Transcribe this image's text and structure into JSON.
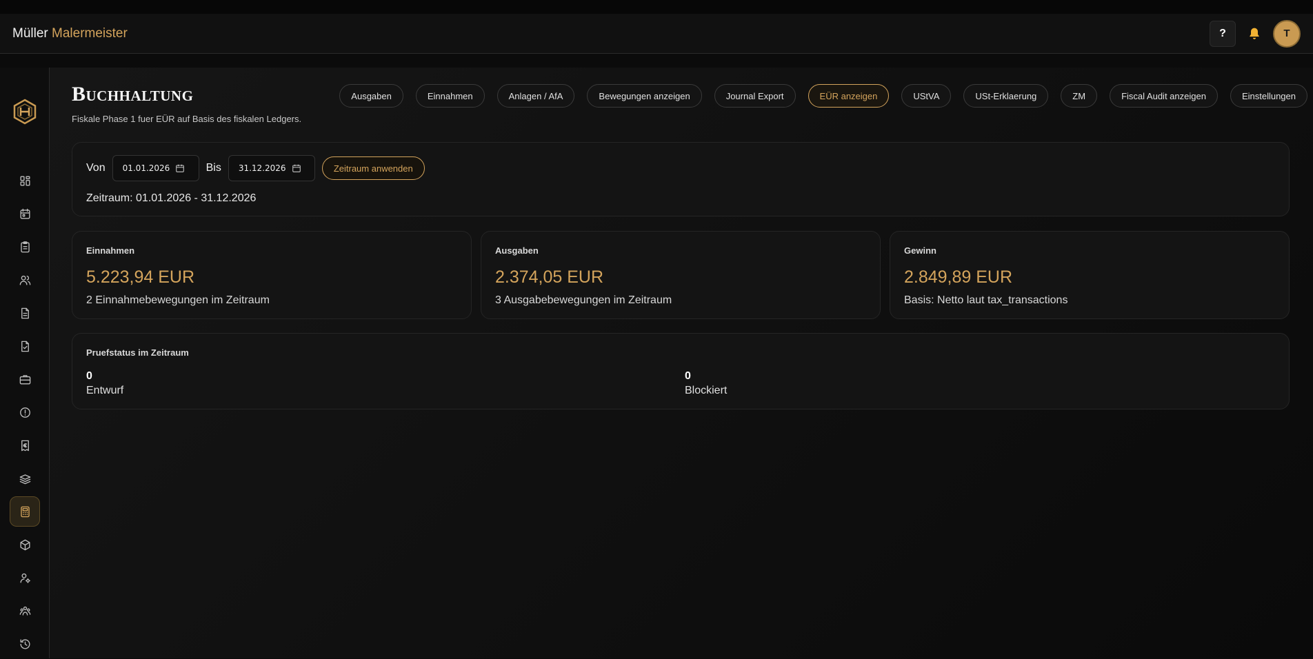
{
  "header": {
    "brand_main": "Müller",
    "brand_accent": "Malermeister",
    "help_label": "?",
    "avatar_initial": "T"
  },
  "sidebar": {
    "items": [
      {
        "icon": "dashboard-icon"
      },
      {
        "icon": "calendar-icon"
      },
      {
        "icon": "clipboard-icon"
      },
      {
        "icon": "users-icon"
      },
      {
        "icon": "document-icon"
      },
      {
        "icon": "document-check-icon"
      },
      {
        "icon": "briefcase-icon"
      },
      {
        "icon": "alert-circle-icon"
      },
      {
        "icon": "euro-receipt-icon"
      },
      {
        "icon": "layers-icon"
      },
      {
        "icon": "calculator-icon",
        "active": true
      },
      {
        "icon": "package-icon"
      },
      {
        "icon": "user-settings-icon"
      },
      {
        "icon": "team-icon"
      },
      {
        "icon": "history-icon"
      }
    ]
  },
  "page": {
    "title": "Buchhaltung",
    "subtitle": "Fiskale Phase 1 fuer EÜR auf Basis des fiskalen Ledgers."
  },
  "tabs": [
    {
      "label": "Ausgaben"
    },
    {
      "label": "Einnahmen"
    },
    {
      "label": "Anlagen / AfA"
    },
    {
      "label": "Bewegungen anzeigen"
    },
    {
      "label": "Journal Export"
    },
    {
      "label": "EÜR anzeigen",
      "active": true
    },
    {
      "label": "UStVA"
    },
    {
      "label": "USt-Erklaerung"
    },
    {
      "label": "ZM"
    },
    {
      "label": "Fiscal Audit anzeigen"
    },
    {
      "label": "Einstellungen"
    }
  ],
  "filter": {
    "from_label": "Von",
    "from_value": "01.01.2026",
    "to_label": "Bis",
    "to_value": "31.12.2026",
    "apply_label": "Zeitraum anwenden",
    "period_text": "Zeitraum: 01.01.2026 - 31.12.2026"
  },
  "stats": [
    {
      "label": "Einnahmen",
      "value": "5.223,94 EUR",
      "note": "2 Einnahmebewegungen im Zeitraum"
    },
    {
      "label": "Ausgaben",
      "value": "2.374,05 EUR",
      "note": "3 Ausgabebewegungen im Zeitraum"
    },
    {
      "label": "Gewinn",
      "value": "2.849,89 EUR",
      "note": "Basis: Netto laut tax_transactions"
    }
  ],
  "status": {
    "title": "Pruefstatus im Zeitraum",
    "items": [
      {
        "count": "0",
        "label": "Entwurf"
      },
      {
        "count": "0",
        "label": "Blockiert"
      }
    ]
  },
  "colors": {
    "accent": "#d4a45c",
    "background": "#0b0b0b",
    "card": "#141414"
  }
}
